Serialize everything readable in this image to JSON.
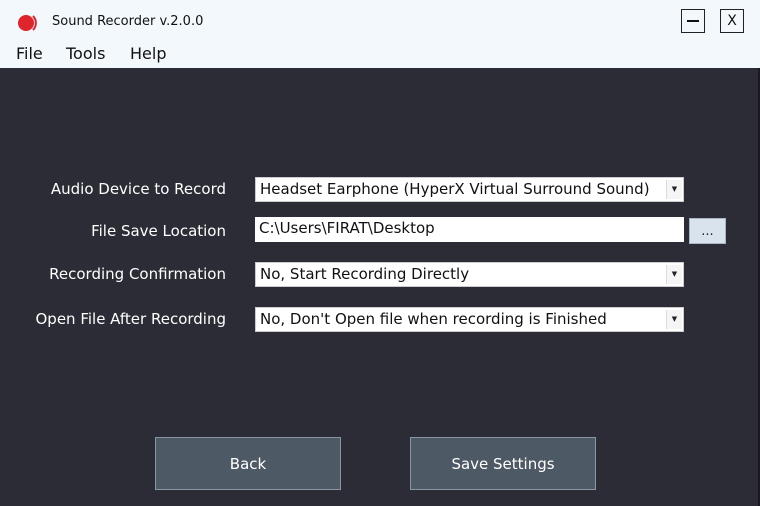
{
  "window": {
    "title": "Sound Recorder v.2.0.0",
    "minimize_label": "",
    "close_label": "X",
    "icon": "record-icon"
  },
  "menu": {
    "file": "File",
    "tools": "Tools",
    "help": "Help"
  },
  "settings": {
    "audio_device": {
      "label": "Audio Device to Record",
      "value": "Headset Earphone (HyperX Virtual Surround Sound)"
    },
    "file_save_location": {
      "label": "File Save Location",
      "value": "C:\\Users\\FIRAT\\Desktop",
      "browse_label": "..."
    },
    "recording_confirmation": {
      "label": "Recording Confirmation",
      "value": "No, Start Recording Directly"
    },
    "open_file_after": {
      "label": "Open File After Recording",
      "value": "No, Don't Open file when recording is Finished"
    }
  },
  "buttons": {
    "back": "Back",
    "save": "Save Settings"
  },
  "colors": {
    "background": "#2b2c35",
    "titlebar": "#f3f8fd",
    "button": "#4e5966",
    "record_icon": "#e0242b"
  }
}
